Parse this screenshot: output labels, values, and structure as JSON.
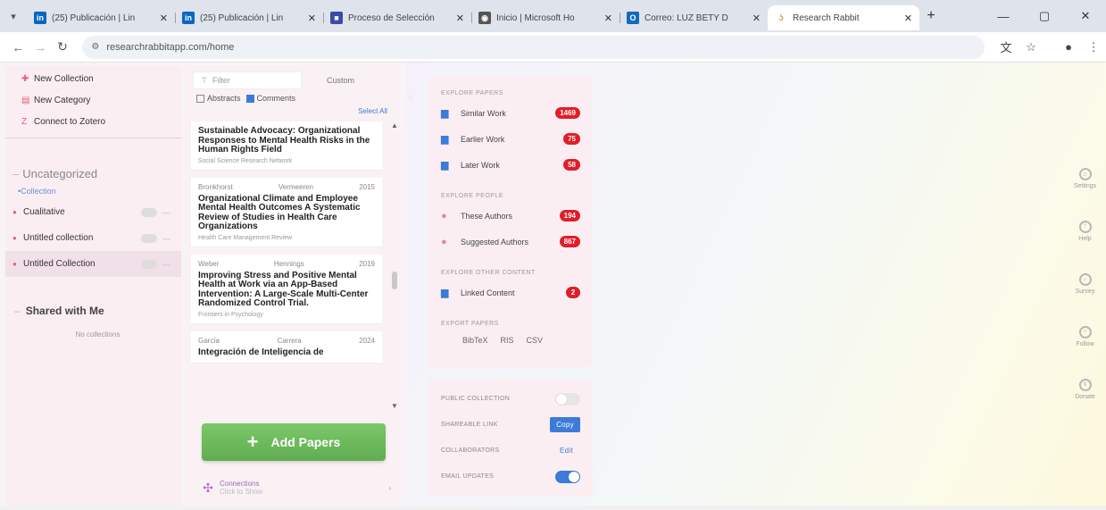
{
  "browser": {
    "tabs": [
      {
        "title": "(25) Publicación | Lin",
        "favicon_color": "#0a66c2",
        "favicon": "in"
      },
      {
        "title": "(25) Publicación | Lin",
        "favicon_color": "#0a66c2",
        "favicon": "in"
      },
      {
        "title": "Proceso de Selección",
        "favicon_color": "#3b4aa8",
        "favicon": "■"
      },
      {
        "title": "Inicio | Microsoft Ho",
        "favicon_color": "#555555",
        "favicon": "◉"
      },
      {
        "title": "Correo: LUZ BETY D",
        "favicon_color": "#0f6cbd",
        "favicon": "O"
      },
      {
        "title": "Research Rabbit",
        "favicon_color": "#ffffff",
        "favicon": "🐇",
        "active": true
      }
    ],
    "new_tab": "+",
    "window_controls": [
      "—",
      "▢",
      "✕"
    ],
    "url": "researchrabbitapp.com/home"
  },
  "sidebar": {
    "actions": [
      {
        "icon": "new-collection-icon",
        "glyph": "✚",
        "label": "New Collection"
      },
      {
        "icon": "new-category-icon",
        "glyph": "▤",
        "label": "New Category"
      },
      {
        "icon": "zotero-icon",
        "glyph": "Z",
        "label": "Connect to Zotero"
      }
    ],
    "category_heading": "Uncategorized",
    "collections_label": "Collection",
    "collections": [
      {
        "label": "Cualitative",
        "selected": false
      },
      {
        "label": "Untitled collection",
        "selected": false
      },
      {
        "label": "Untitled Collection",
        "selected": true
      }
    ],
    "shared_heading": "Shared with Me",
    "shared_empty": "No collections"
  },
  "papers": {
    "filter_placeholder": "Filter",
    "custom_label": "Custom",
    "abstracts_label": "Abstracts",
    "comments_label": "Comments",
    "select_all": "Select All",
    "items": [
      {
        "authors_first": "",
        "authors_last": "",
        "year": "",
        "title": "Sustainable Advocacy: Organizational Responses to Mental Health Risks in the Human Rights Field",
        "journal": "Social Science Research Network"
      },
      {
        "authors_first": "Bronkhorst",
        "authors_last": "Vermeeren",
        "year": "2015",
        "title": "Organizational Climate and Employee Mental Health Outcomes A Systematic Review of Studies in Health Care Organizations",
        "journal": "Health Care Management Review"
      },
      {
        "authors_first": "Weber",
        "authors_last": "Hennings",
        "year": "2019",
        "title": "Improving Stress and Positive Mental Health at Work via an App-Based Intervention: A Large-Scale Multi-Center Randomized Control Trial.",
        "journal": "Frontiers in Psychology"
      },
      {
        "authors_first": "García",
        "authors_last": "Carrera",
        "year": "2024",
        "title": "Integración de Inteligencia de",
        "journal": ""
      }
    ],
    "add_papers_label": "Add Papers",
    "connected_title": "Connections",
    "connected_sub": "Click to Show"
  },
  "explore": {
    "papers_heading": "EXPLORE PAPERS",
    "papers": [
      {
        "label": "Similar Work",
        "count": "1469"
      },
      {
        "label": "Earlier Work",
        "count": "75"
      },
      {
        "label": "Later Work",
        "count": "58"
      }
    ],
    "people_heading": "EXPLORE PEOPLE",
    "people": [
      {
        "label": "These Authors",
        "count": "194"
      },
      {
        "label": "Suggested Authors",
        "count": "867"
      }
    ],
    "other_heading": "EXPLORE OTHER CONTENT",
    "other": [
      {
        "label": "Linked Content",
        "count": "2"
      }
    ],
    "export_heading": "EXPORT PAPERS",
    "export_formats": [
      "BibTeX",
      "RIS",
      "CSV"
    ]
  },
  "collection_settings": {
    "public_label": "PUBLIC COLLECTION",
    "public_on": false,
    "share_label": "SHAREABLE LINK",
    "copy_label": "Copy",
    "collab_label": "COLLABORATORS",
    "edit_label": "Edit",
    "email_label": "EMAIL UPDATES",
    "email_on": true
  },
  "rail": [
    {
      "label": "Settings",
      "icon": "settings-icon"
    },
    {
      "label": "Help",
      "icon": "help-icon"
    },
    {
      "label": "Survey",
      "icon": "survey-icon"
    },
    {
      "label": "Follow",
      "icon": "follow-icon"
    },
    {
      "label": "Donate",
      "icon": "donate-icon"
    }
  ]
}
